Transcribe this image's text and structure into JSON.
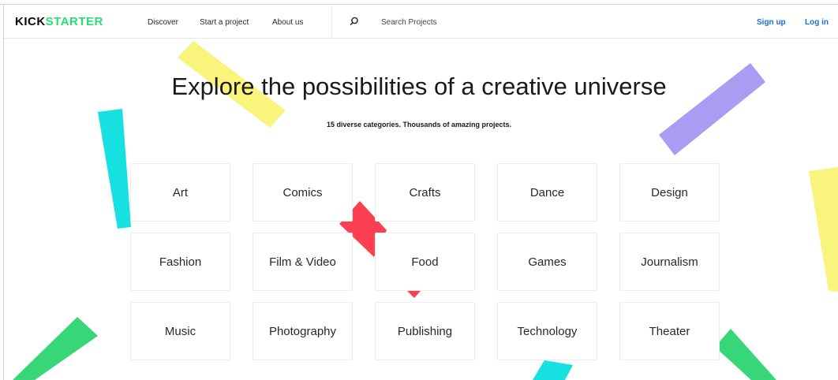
{
  "header": {
    "logo_part1": "KICK",
    "logo_part2": "STARTER",
    "nav": {
      "discover": "Discover",
      "start_project": "Start a project",
      "about": "About us"
    },
    "search": {
      "placeholder": "Search Projects"
    },
    "sign_up": "Sign up",
    "log_in": "Log in"
  },
  "hero": {
    "title": "Explore the possibilities of a creative universe",
    "subtitle": "15 diverse categories. Thousands of amazing projects."
  },
  "categories": [
    "Art",
    "Comics",
    "Crafts",
    "Dance",
    "Design",
    "Fashion",
    "Film & Video",
    "Food",
    "Games",
    "Journalism",
    "Music",
    "Photography",
    "Publishing",
    "Technology",
    "Theater"
  ],
  "colors": {
    "brand_green": "#2bde73",
    "link_blue": "#1b6fd1",
    "confetti_yellow": "#f8f47c",
    "confetti_purple": "#a89cf3",
    "confetti_cyan": "#16e0e0",
    "confetti_red": "#fd3f52",
    "confetti_green": "#36d679"
  }
}
